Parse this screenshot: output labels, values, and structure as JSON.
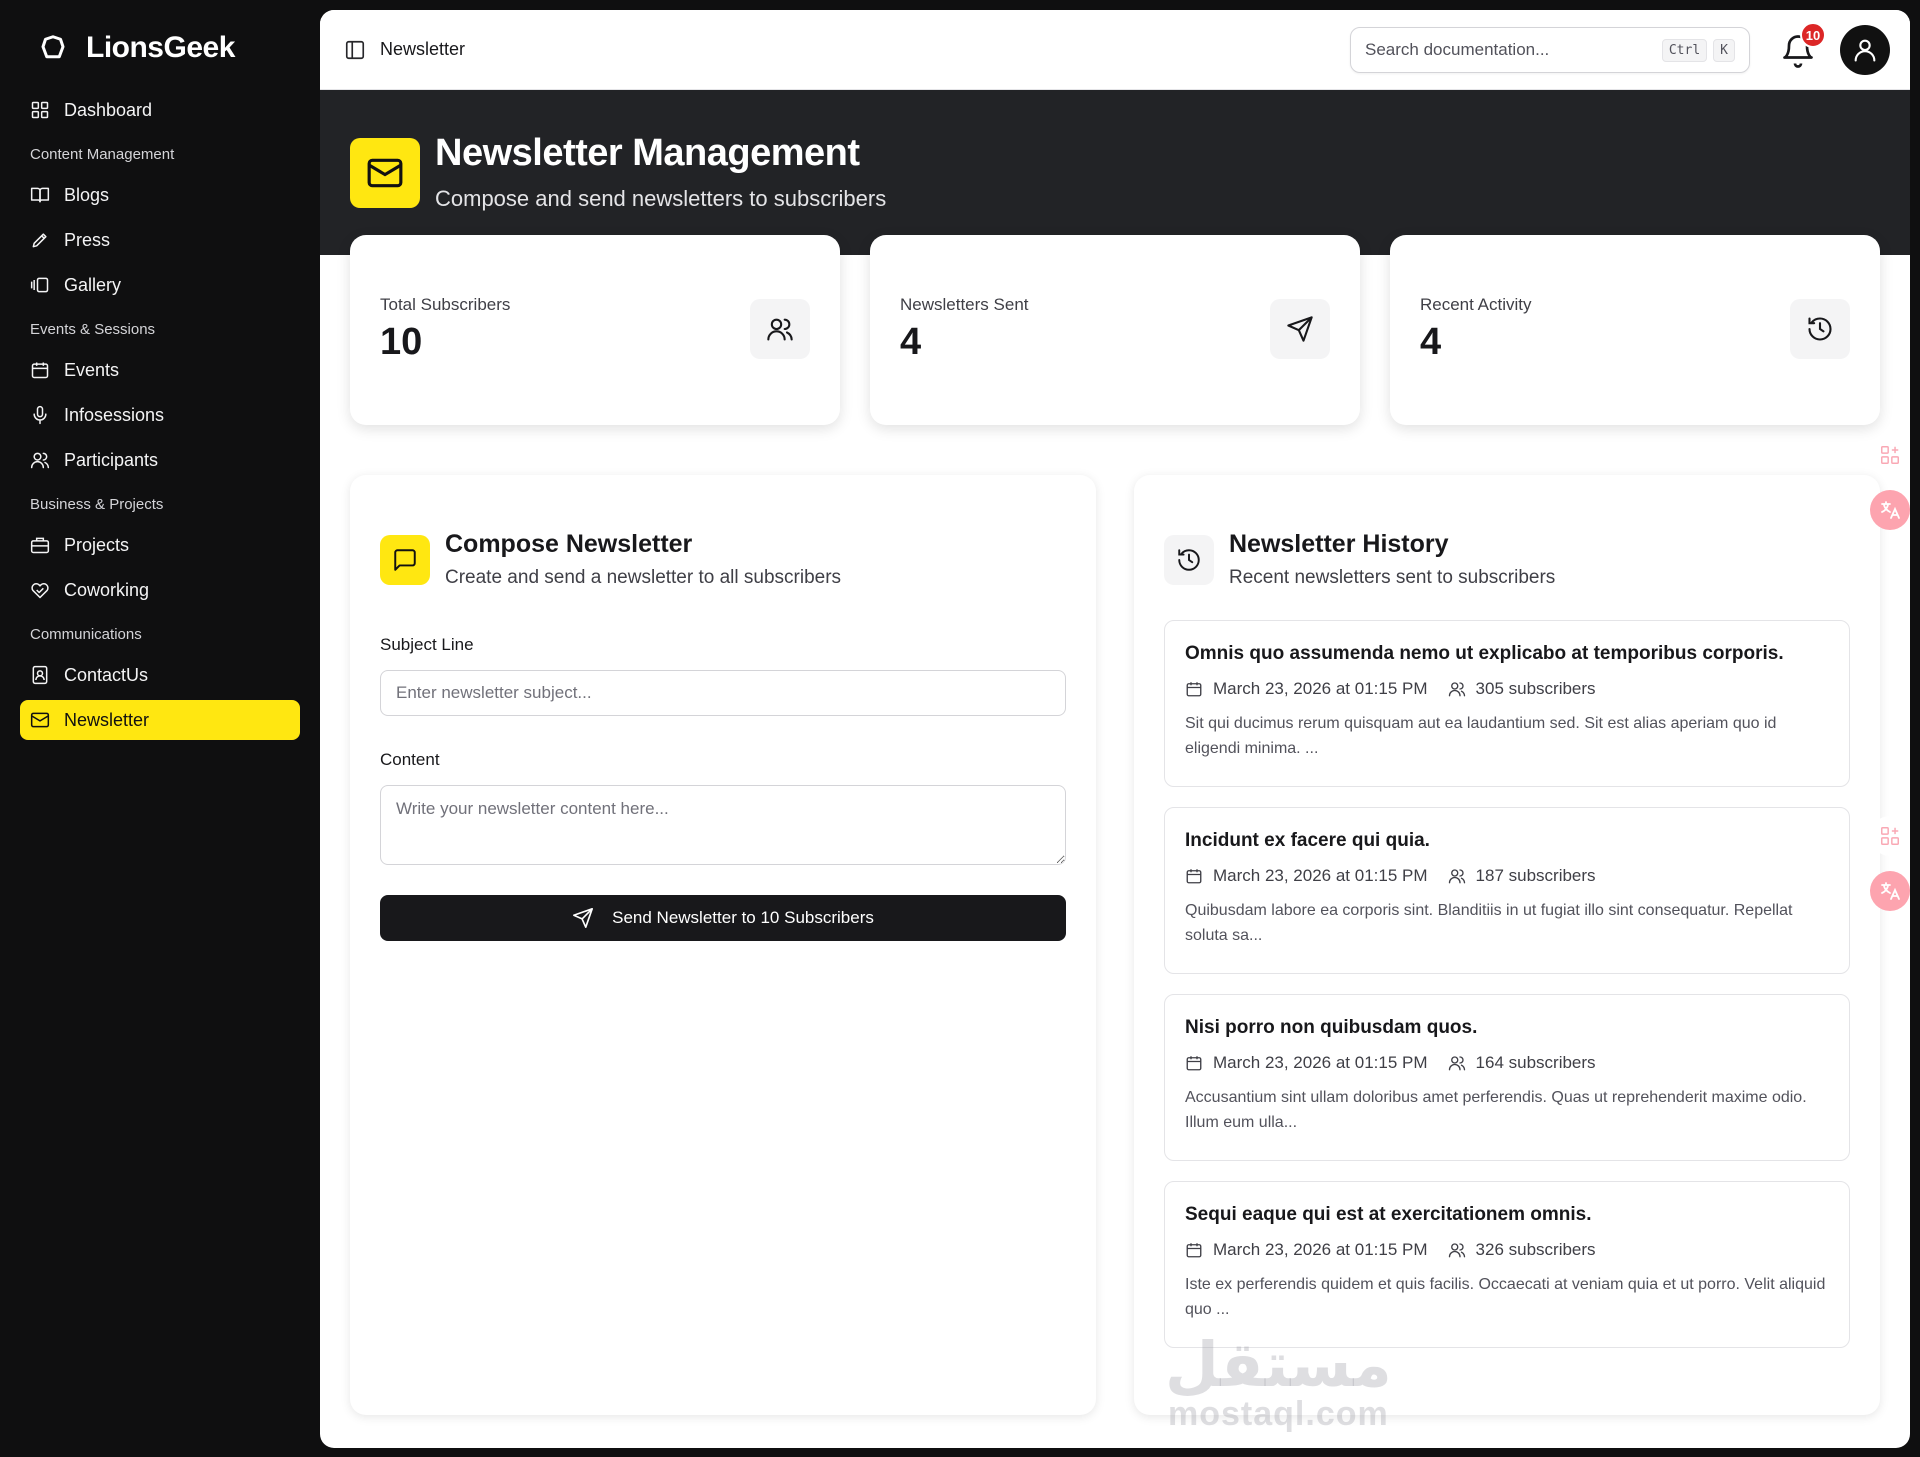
{
  "brand": {
    "name": "LionsGeek"
  },
  "sidebar": {
    "dashboard": "Dashboard",
    "groups": {
      "content": "Content Management",
      "events": "Events & Sessions",
      "business": "Business & Projects",
      "comms": "Communications"
    },
    "items": {
      "blogs": "Blogs",
      "press": "Press",
      "gallery": "Gallery",
      "events": "Events",
      "infosessions": "Infosessions",
      "participants": "Participants",
      "projects": "Projects",
      "coworking": "Coworking",
      "contactus": "ContactUs",
      "newsletter": "Newsletter"
    },
    "active": "newsletter"
  },
  "topbar": {
    "breadcrumb": "Newsletter",
    "search_placeholder": "Search documentation...",
    "kbd_ctrl": "Ctrl",
    "kbd_k": "K",
    "notification_count": "10"
  },
  "hero": {
    "title": "Newsletter Management",
    "subtitle": "Compose and send newsletters to subscribers"
  },
  "stats": [
    {
      "label": "Total Subscribers",
      "value": "10",
      "icon": "users-icon"
    },
    {
      "label": "Newsletters Sent",
      "value": "4",
      "icon": "send-icon"
    },
    {
      "label": "Recent Activity",
      "value": "4",
      "icon": "history-icon"
    }
  ],
  "compose": {
    "title": "Compose Newsletter",
    "subtitle": "Create and send a newsletter to all subscribers",
    "subject_label": "Subject Line",
    "subject_placeholder": "Enter newsletter subject...",
    "content_label": "Content",
    "content_placeholder": "Write your newsletter content here...",
    "send_label": "Send Newsletter to 10 Subscribers"
  },
  "history": {
    "title": "Newsletter History",
    "subtitle": "Recent newsletters sent to subscribers",
    "items": [
      {
        "title": "Omnis quo assumenda nemo ut explicabo at temporibus corporis.",
        "date": "March 23, 2026 at 01:15 PM",
        "subscribers": "305 subscribers",
        "excerpt": "Sit qui ducimus rerum quisquam aut ea laudantium sed. Sit est alias aperiam quo id eligendi minima. ..."
      },
      {
        "title": "Incidunt ex facere qui quia.",
        "date": "March 23, 2026 at 01:15 PM",
        "subscribers": "187 subscribers",
        "excerpt": "Quibusdam labore ea corporis sint. Blanditiis in ut fugiat illo sint consequatur. Repellat soluta sa..."
      },
      {
        "title": "Nisi porro non quibusdam quos.",
        "date": "March 23, 2026 at 01:15 PM",
        "subscribers": "164 subscribers",
        "excerpt": "Accusantium sint ullam doloribus amet perferendis. Quas ut reprehenderit maxime odio. Illum eum ulla..."
      },
      {
        "title": "Sequi eaque qui est at exercitationem omnis.",
        "date": "March 23, 2026 at 01:15 PM",
        "subscribers": "326 subscribers",
        "excerpt": "Iste ex perferendis quidem et quis facilis. Occaecati at veniam quia et ut porro. Velit aliquid quo ..."
      }
    ]
  },
  "watermark": {
    "arabic": "مستقل",
    "latin": "mostaql.com"
  },
  "colors": {
    "accent": "#ffe711",
    "dark": "#18181b",
    "sidebar_bg": "#0f0f10",
    "hero_bg": "#222326",
    "badge": "#dc2626"
  }
}
